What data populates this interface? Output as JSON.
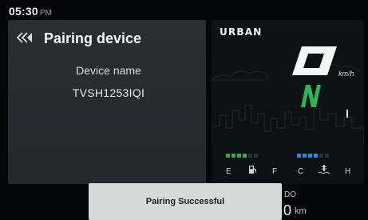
{
  "status_bar": {
    "time": "05:30",
    "ampm": "PM"
  },
  "pairing": {
    "title": "Pairing device",
    "device_name_label": "Device name",
    "device_name_value": "TVSH1253IQI"
  },
  "ride": {
    "mode": "URBAN",
    "speed_unit": "km/h",
    "gear": "N",
    "gear_color": "#2fb35a",
    "fuel": {
      "labels": [
        "E",
        "F"
      ],
      "level_segments": 4,
      "total_segments": 6,
      "color": "#3fa64a",
      "icon": "fuel-pump-icon"
    },
    "temperature": {
      "labels": [
        "C",
        "H"
      ],
      "level_segments": 4,
      "total_segments": 6,
      "color": "#2f8ad6",
      "icon": "coolant-temperature-icon"
    }
  },
  "odometer": {
    "label": "DO",
    "value": "0",
    "unit": "km"
  },
  "toast": {
    "message": "Pairing Successful"
  }
}
